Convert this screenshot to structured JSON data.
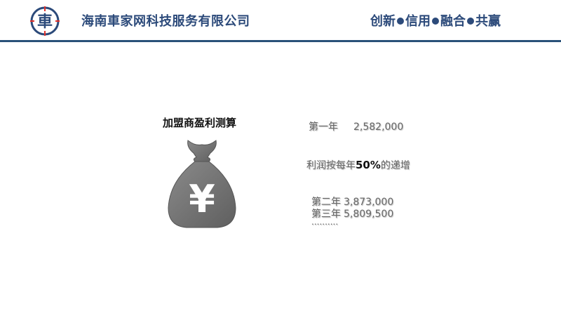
{
  "header": {
    "company_name": "海南車家网科技服务有限公司",
    "logo_text": "車",
    "slogan": [
      "创新",
      "信用",
      "融合",
      "共赢"
    ]
  },
  "main": {
    "calc_title": "加盟商盈利测算",
    "bag_symbol": "¥",
    "year1": {
      "label": "第一年",
      "value": "2,582,000"
    },
    "growth": {
      "prefix": "利润按每年",
      "percent": "50%",
      "suffix": "的递增"
    },
    "years": [
      {
        "label": "第二年",
        "value": "3,873,000"
      },
      {
        "label": "第三年",
        "value": "5,809,500"
      }
    ],
    "ellipsis": ".........."
  },
  "colors": {
    "brand_blue": "#2c4a7a",
    "rule": "#2a5279",
    "accent_red": "#e0312b",
    "bag_gray": "#7a7a7a"
  }
}
